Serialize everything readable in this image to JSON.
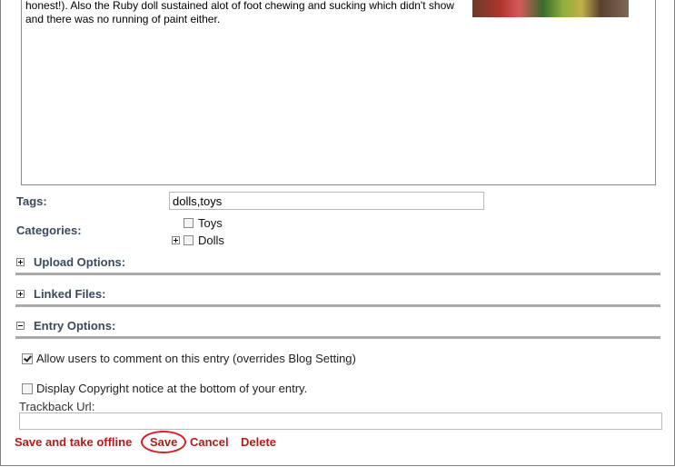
{
  "editor": {
    "lines": [
      "honest!). Also the Ruby doll sustained alot of foot chewing and sucking which didn't show",
      "and there was no running of paint either."
    ]
  },
  "tags": {
    "label": "Tags:",
    "value": "dolls,toys"
  },
  "categories": {
    "label": "Categories:",
    "items": [
      {
        "label": "Toys",
        "checked": false,
        "expandable": false
      },
      {
        "label": "Dolls",
        "checked": false,
        "expandable": true
      }
    ]
  },
  "sections": {
    "upload": "Upload Options:",
    "linked": "Linked Files:",
    "entry": "Entry Options:"
  },
  "entry_options": {
    "allow_comments": {
      "label": "Allow users to comment on this entry (overrides Blog Setting)",
      "checked": true
    },
    "copyright": {
      "label": "Display Copyright notice at the bottom of your entry.",
      "checked": false
    },
    "trackback_label": "Trackback Url:",
    "trackback_value": ""
  },
  "actions": {
    "save_offline": "Save and take offline",
    "save": "Save",
    "cancel": "Cancel",
    "delete": "Delete"
  },
  "colors": {
    "accent_red": "#b01c1c",
    "label_blue": "#3a4a5c",
    "rule_gray": "#a9a9a9"
  }
}
